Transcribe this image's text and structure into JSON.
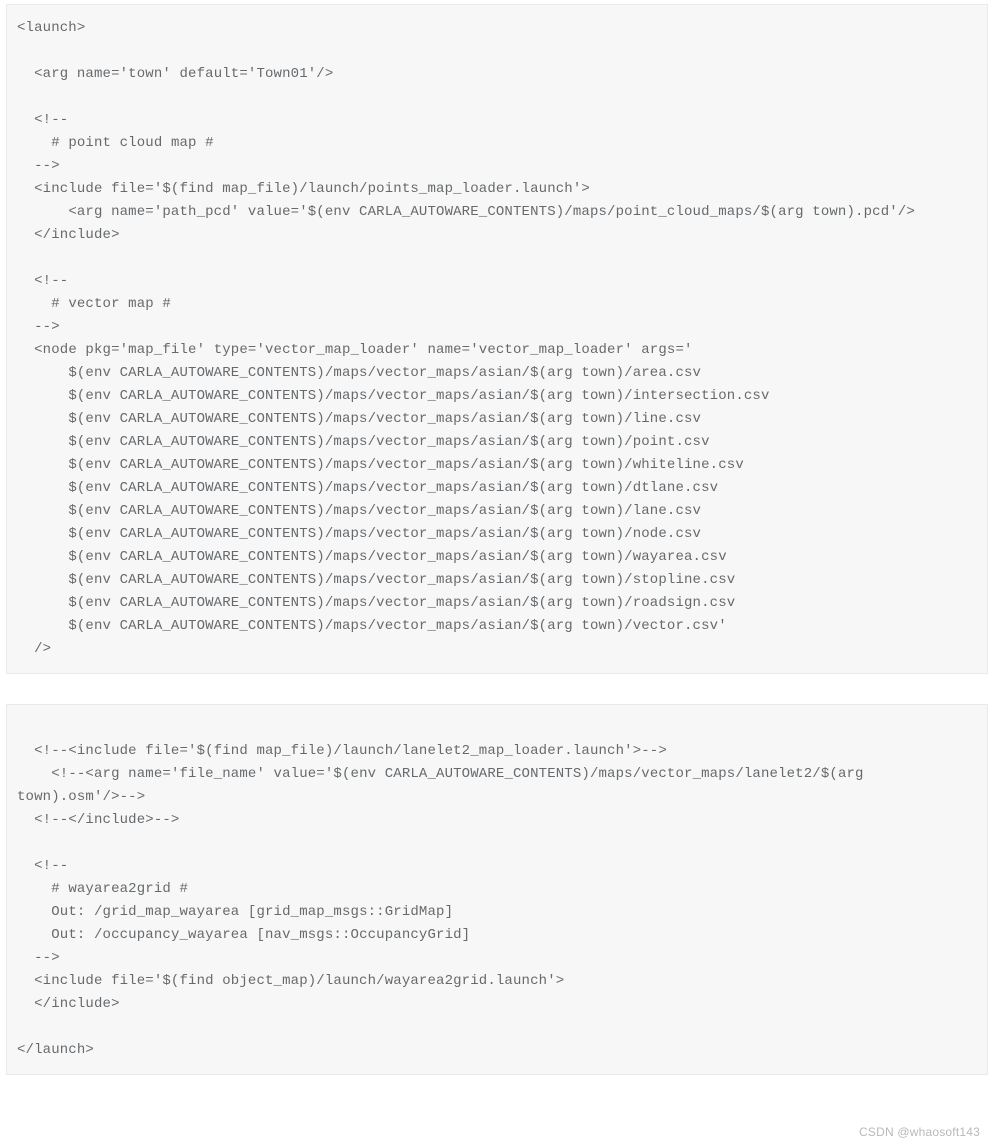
{
  "code_block1": {
    "lines": [
      "<launch>",
      "",
      "  <arg name='town' default='Town01'/>",
      "",
      "  <!--",
      "    # point cloud map #",
      "  -->",
      "  <include file='$(find map_file)/launch/points_map_loader.launch'>",
      "      <arg name='path_pcd' value='$(env CARLA_AUTOWARE_CONTENTS)/maps/point_cloud_maps/$(arg town).pcd'/>",
      "  </include>",
      "",
      "  <!--",
      "    # vector map #",
      "  -->",
      "  <node pkg='map_file' type='vector_map_loader' name='vector_map_loader' args='",
      "      $(env CARLA_AUTOWARE_CONTENTS)/maps/vector_maps/asian/$(arg town)/area.csv",
      "      $(env CARLA_AUTOWARE_CONTENTS)/maps/vector_maps/asian/$(arg town)/intersection.csv",
      "      $(env CARLA_AUTOWARE_CONTENTS)/maps/vector_maps/asian/$(arg town)/line.csv",
      "      $(env CARLA_AUTOWARE_CONTENTS)/maps/vector_maps/asian/$(arg town)/point.csv",
      "      $(env CARLA_AUTOWARE_CONTENTS)/maps/vector_maps/asian/$(arg town)/whiteline.csv",
      "      $(env CARLA_AUTOWARE_CONTENTS)/maps/vector_maps/asian/$(arg town)/dtlane.csv",
      "      $(env CARLA_AUTOWARE_CONTENTS)/maps/vector_maps/asian/$(arg town)/lane.csv",
      "      $(env CARLA_AUTOWARE_CONTENTS)/maps/vector_maps/asian/$(arg town)/node.csv",
      "      $(env CARLA_AUTOWARE_CONTENTS)/maps/vector_maps/asian/$(arg town)/wayarea.csv",
      "      $(env CARLA_AUTOWARE_CONTENTS)/maps/vector_maps/asian/$(arg town)/stopline.csv",
      "      $(env CARLA_AUTOWARE_CONTENTS)/maps/vector_maps/asian/$(arg town)/roadsign.csv",
      "      $(env CARLA_AUTOWARE_CONTENTS)/maps/vector_maps/asian/$(arg town)/vector.csv'",
      "  />"
    ]
  },
  "code_block2": {
    "lines": [
      "",
      "  <!--<include file='$(find map_file)/launch/lanelet2_map_loader.launch'>-->",
      "    <!--<arg name='file_name' value='$(env CARLA_AUTOWARE_CONTENTS)/maps/vector_maps/lanelet2/$(arg town).osm'/>-->",
      "  <!--</include>-->",
      "",
      "  <!--",
      "    # wayarea2grid #",
      "    Out: /grid_map_wayarea [grid_map_msgs::GridMap]",
      "    Out: /occupancy_wayarea [nav_msgs::OccupancyGrid]",
      "  -->",
      "  <include file='$(find object_map)/launch/wayarea2grid.launch'>",
      "  </include>",
      "",
      "</launch>"
    ]
  },
  "watermark": "CSDN @whaosoft143"
}
